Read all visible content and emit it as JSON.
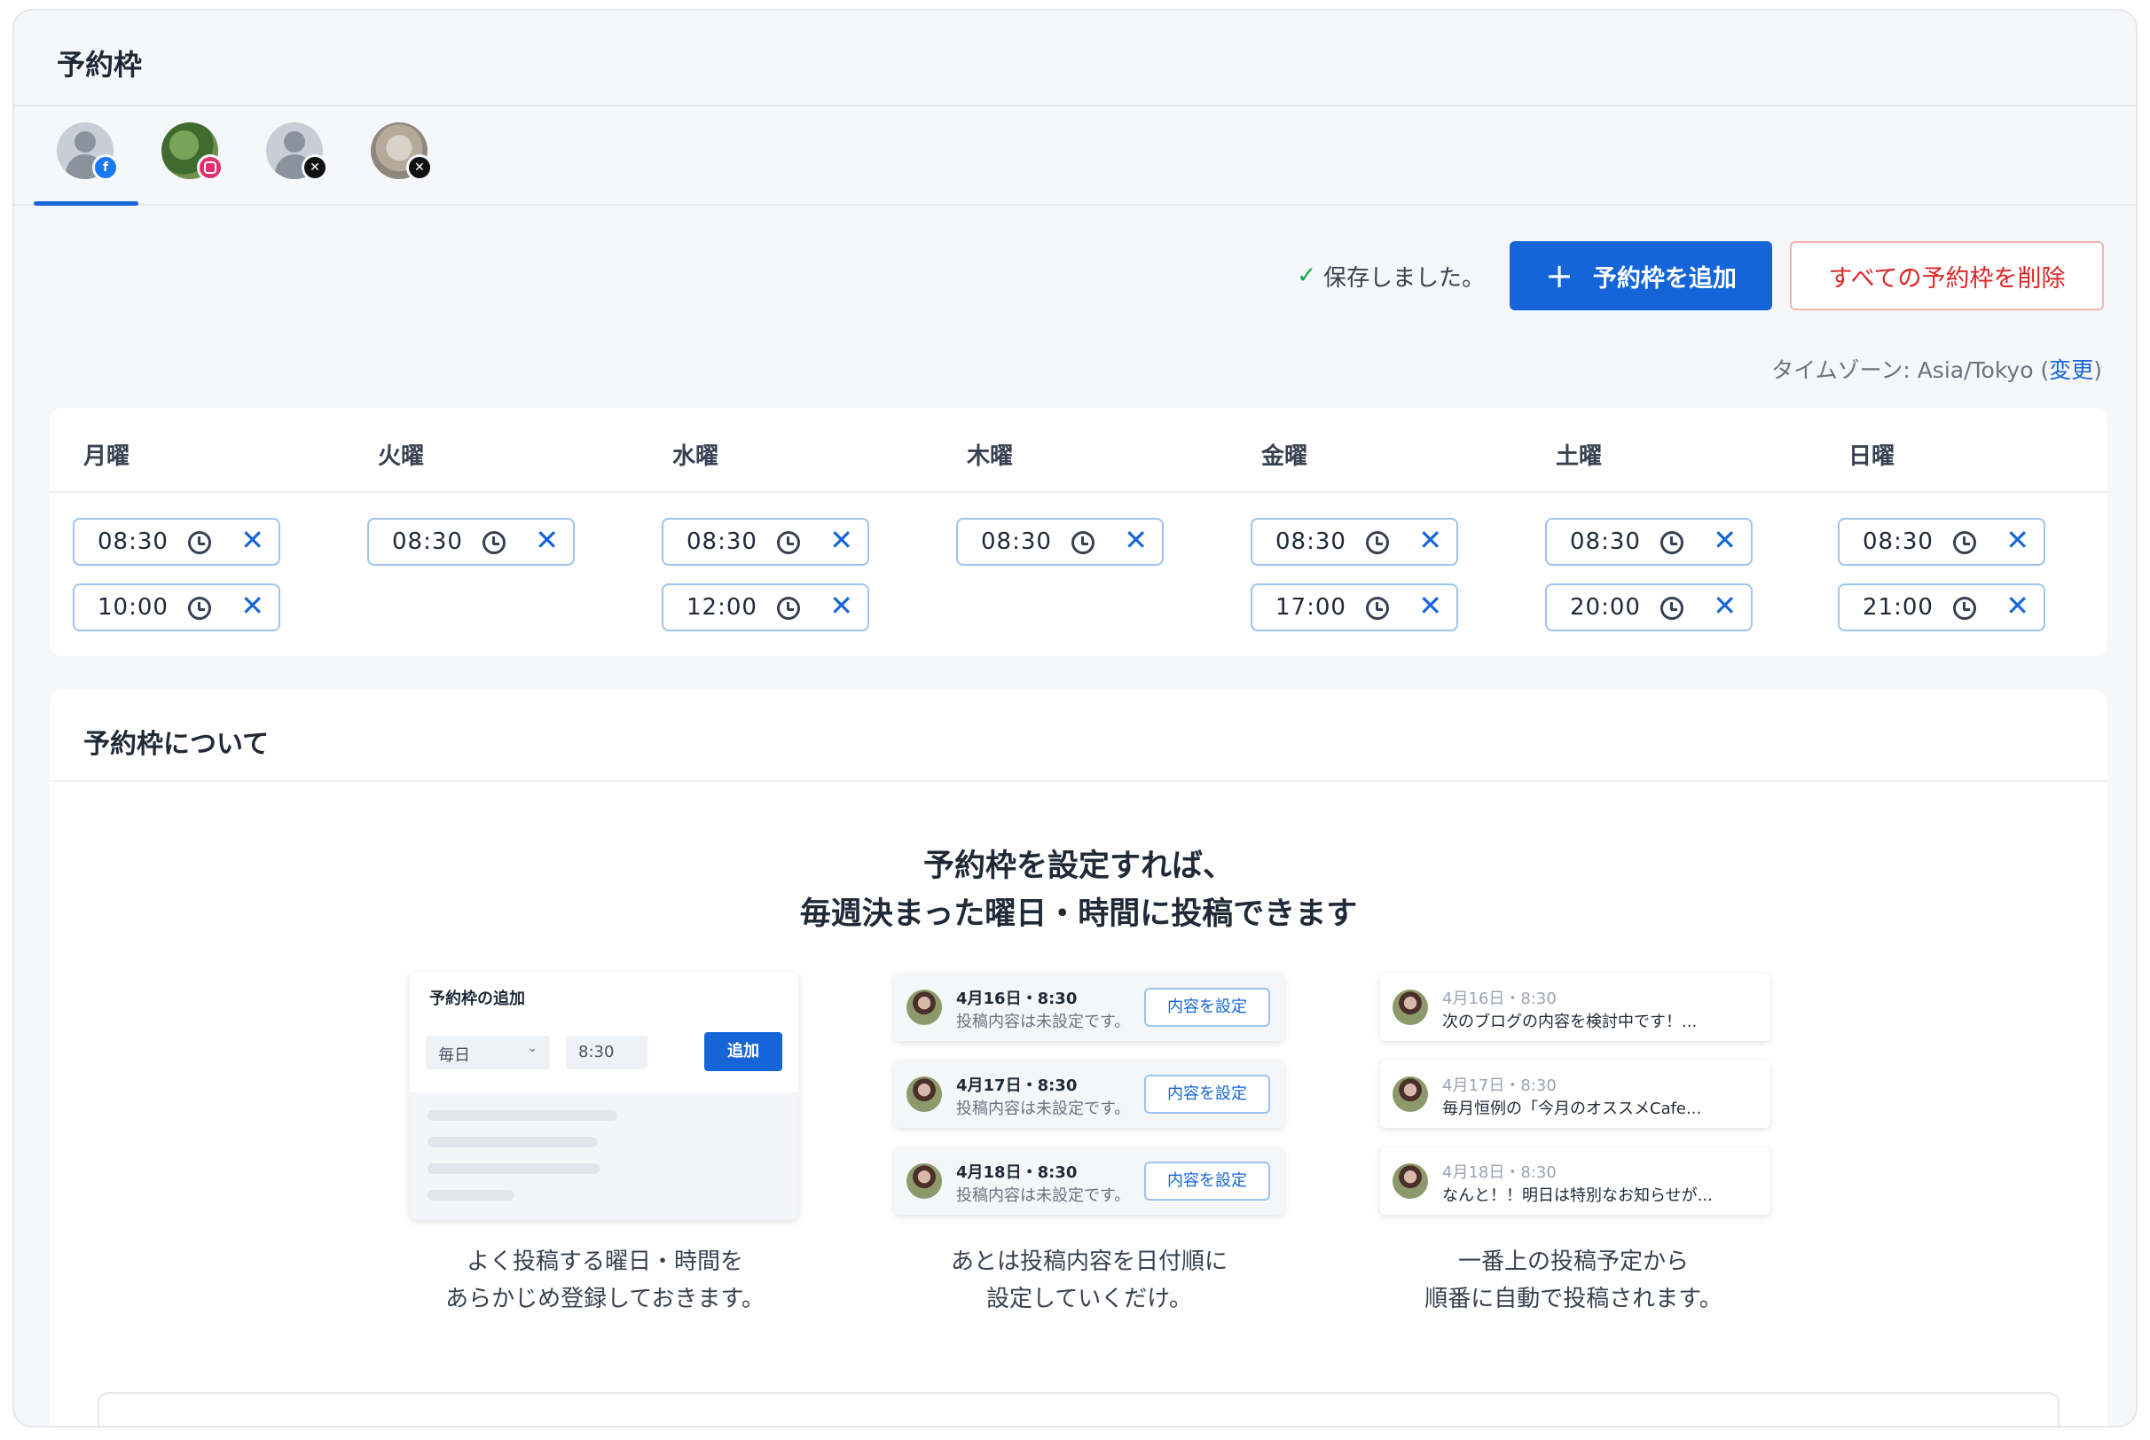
{
  "page": {
    "title": "予約枠"
  },
  "accounts": [
    {
      "name": "facebook-account",
      "network_icon": "facebook-icon",
      "badge_color": "#1877f2",
      "active": true
    },
    {
      "name": "instagram-account",
      "network_icon": "instagram-icon",
      "badge_color": "#e1306c",
      "active": false
    },
    {
      "name": "x-account-1",
      "network_icon": "x-icon",
      "badge_color": "#111111",
      "active": false
    },
    {
      "name": "x-account-2",
      "network_icon": "x-icon",
      "badge_color": "#111111",
      "active": false
    }
  ],
  "toolbar": {
    "saved_text": "保存しました。",
    "add_label": "予約枠を追加",
    "delete_all_label": "すべての予約枠を削除"
  },
  "timezone": {
    "prefix": "タイムゾーン: Asia/Tokyo (",
    "change": "変更",
    "suffix": ")"
  },
  "week": {
    "days": [
      "月曜",
      "火曜",
      "水曜",
      "木曜",
      "金曜",
      "土曜",
      "日曜"
    ],
    "slots": [
      [
        "08:30",
        "10:00"
      ],
      [
        "08:30"
      ],
      [
        "08:30",
        "12:00"
      ],
      [
        "08:30"
      ],
      [
        "08:30",
        "17:00"
      ],
      [
        "08:30",
        "20:00"
      ],
      [
        "08:30",
        "21:00"
      ]
    ]
  },
  "about": {
    "title": "予約枠について",
    "headline_1": "予約枠を設定すれば、",
    "headline_2": "毎週決まった曜日・時間に投稿できます",
    "step1": {
      "card_title": "予約枠の追加",
      "select_value": "毎日",
      "time_value": "8:30",
      "add_label": "追加",
      "caption_1": "よく投稿する曜日・時間を",
      "caption_2": "あらかじめ登録しておきます。"
    },
    "step2": {
      "posts": [
        {
          "date": "4月16日・8:30",
          "status": "投稿内容は未設定です。",
          "button": "内容を設定"
        },
        {
          "date": "4月17日・8:30",
          "status": "投稿内容は未設定です。",
          "button": "内容を設定"
        },
        {
          "date": "4月18日・8:30",
          "status": "投稿内容は未設定です。",
          "button": "内容を設定"
        }
      ],
      "caption_1": "あとは投稿内容を日付順に",
      "caption_2": "設定していくだけ。"
    },
    "step3": {
      "posts": [
        {
          "date": "4月16日・8:30",
          "text": "次のブログの内容を検討中です！..."
        },
        {
          "date": "4月17日・8:30",
          "text": "毎月恒例の「今月のオススメCafe..."
        },
        {
          "date": "4月18日・8:30",
          "text": "なんと！！明日は特別なお知らせが..."
        }
      ],
      "caption_1": "一番上の投稿予定から",
      "caption_2": "順番に自動で投稿されます。"
    }
  },
  "colors": {
    "accent": "#1565d8",
    "danger": "#dc2626",
    "success": "#16a34a"
  }
}
